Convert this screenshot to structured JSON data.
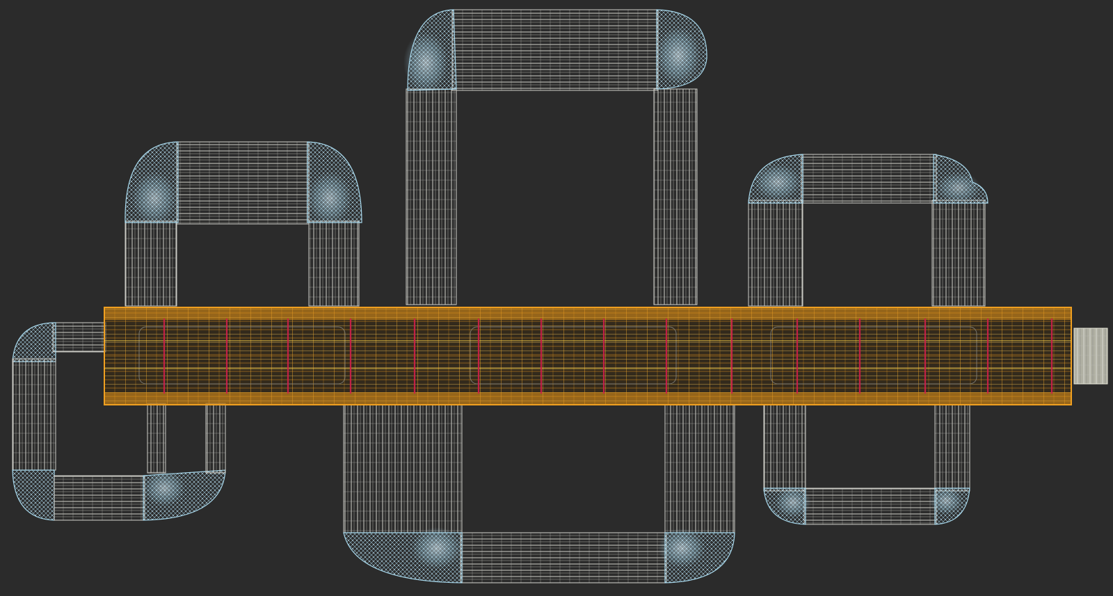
{
  "scene": {
    "background": "#2b2b2b",
    "colors": {
      "wire_white": "#e8e8e2",
      "wire_grey": "#9a9a94",
      "bend_blue": "#a8d8ec",
      "conduit_orange": "#f0a020",
      "conduit_yellow": "#ffd24a",
      "conduit_red": "#d0204a"
    },
    "objects": [
      "main-conduit",
      "loop-top-center",
      "loop-top-left",
      "loop-top-right",
      "loop-bottom-left",
      "loop-bottom-center",
      "loop-bottom-right",
      "end-connector"
    ]
  }
}
